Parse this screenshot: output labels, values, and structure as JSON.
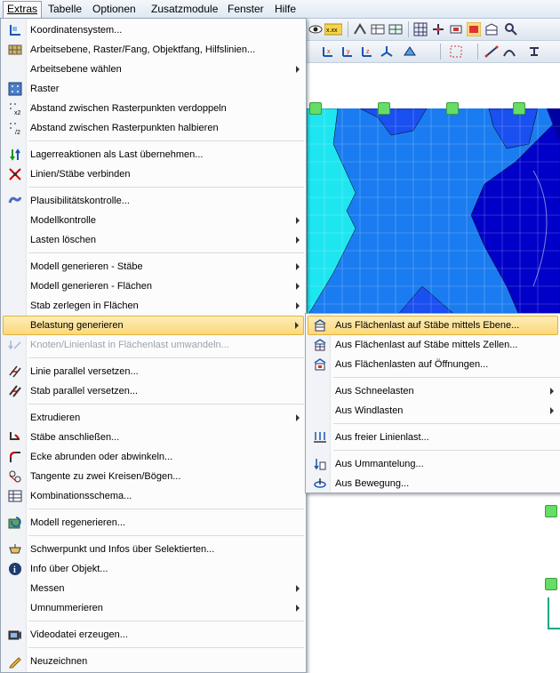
{
  "menubar": {
    "items": [
      "Extras",
      "Tabelle",
      "Optionen",
      "Zusatzmodule",
      "Fenster",
      "Hilfe"
    ]
  },
  "menu": {
    "items": [
      {
        "label": "Koordinatensystem...",
        "icon": "coordinate-system-icon"
      },
      {
        "label": "Arbeitsebene, Raster/Fang, Objektfang, Hilfslinien...",
        "icon": "grid-snap-icon"
      },
      {
        "label": "Arbeitsebene wählen",
        "icon": "",
        "submenu": true
      },
      {
        "label": "Raster",
        "icon": "grid-icon"
      },
      {
        "label": "Abstand zwischen Rasterpunkten verdoppeln",
        "icon": "grid-double-icon"
      },
      {
        "label": "Abstand zwischen Rasterpunkten halbieren",
        "icon": "grid-half-icon"
      },
      {
        "label": "Lagerreaktionen als Last übernehmen...",
        "icon": "support-reactions-icon"
      },
      {
        "label": "Linien/Stäbe verbinden",
        "icon": "connect-lines-icon"
      },
      {
        "label": "Plausibilitätskontrolle...",
        "icon": "plausibility-check-icon"
      },
      {
        "label": "Modellkontrolle",
        "icon": "",
        "submenu": true
      },
      {
        "label": "Lasten löschen",
        "icon": "",
        "submenu": true
      },
      {
        "label": "Modell generieren - Stäbe",
        "icon": "",
        "submenu": true
      },
      {
        "label": "Modell generieren - Flächen",
        "icon": "",
        "submenu": true
      },
      {
        "label": "Stab zerlegen in Flächen",
        "icon": "",
        "submenu": true
      },
      {
        "label": "Belastung generieren",
        "icon": "",
        "submenu": true
      },
      {
        "label": "Knoten/Linienlast in Flächenlast umwandeln...",
        "icon": "convert-load-icon",
        "disabled": true
      },
      {
        "label": "Linie parallel versetzen...",
        "icon": "offset-line-icon"
      },
      {
        "label": "Stab parallel versetzen...",
        "icon": "offset-member-icon"
      },
      {
        "label": "Extrudieren",
        "icon": "",
        "submenu": true
      },
      {
        "label": "Stäbe anschließen...",
        "icon": "connect-members-icon"
      },
      {
        "label": "Ecke abrunden oder abwinkeln...",
        "icon": "round-corner-icon"
      },
      {
        "label": "Tangente zu zwei Kreisen/Bögen...",
        "icon": "tangent-icon"
      },
      {
        "label": "Kombinationsschema...",
        "icon": "combination-scheme-icon"
      },
      {
        "label": "Modell regenerieren...",
        "icon": "regenerate-model-icon"
      },
      {
        "label": "Schwerpunkt und Infos über Selektierten...",
        "icon": "center-of-gravity-icon"
      },
      {
        "label": "Info über Objekt...",
        "icon": "object-info-icon"
      },
      {
        "label": "Messen",
        "icon": "",
        "submenu": true
      },
      {
        "label": "Umnummerieren",
        "icon": "",
        "submenu": true
      },
      {
        "label": "Videodatei erzeugen...",
        "icon": "video-file-icon"
      },
      {
        "label": "Neuzeichnen",
        "icon": "redraw-pencil-icon"
      }
    ]
  },
  "submenu": {
    "items": [
      {
        "label": "Aus Flächenlast auf Stäbe mittels Ebene...",
        "icon": "area-load-plane-icon"
      },
      {
        "label": "Aus Flächenlast auf Stäbe mittels Zellen...",
        "icon": "area-load-cells-icon"
      },
      {
        "label": "Aus Flächenlasten auf Öffnungen...",
        "icon": "area-load-openings-icon"
      },
      {
        "label": "Aus Schneelasten",
        "icon": "",
        "submenu": true
      },
      {
        "label": "Aus Windlasten",
        "icon": "",
        "submenu": true
      },
      {
        "label": "Aus freier Linienlast...",
        "icon": "free-line-load-icon"
      },
      {
        "label": "Aus Ummantelung...",
        "icon": "encasement-icon"
      },
      {
        "label": "Aus Bewegung...",
        "icon": "motion-icon"
      }
    ]
  },
  "colors": {
    "highlight": "#fbd87a",
    "fem_dark": "#0000c8",
    "fem_mid": "#1a7cf0",
    "fem_cyan": "#1ee6f0",
    "support_green": "#66dd66"
  }
}
